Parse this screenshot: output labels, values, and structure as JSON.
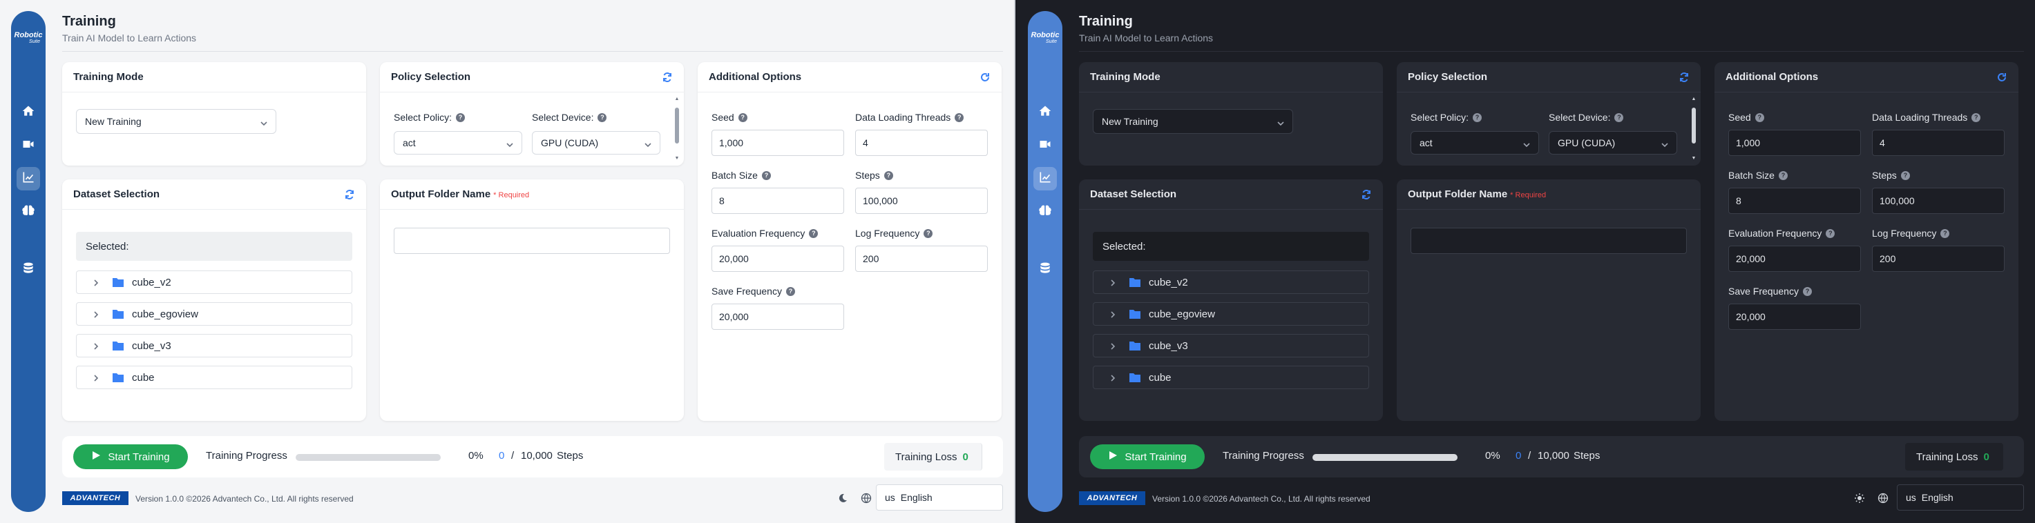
{
  "app": {
    "logo_text": "Robotic",
    "logo_sub": "Suite",
    "title": "Training",
    "subtitle": "Train AI Model to Learn Actions"
  },
  "sidebar": {
    "items": [
      {
        "icon": "home-icon"
      },
      {
        "icon": "video-icon"
      },
      {
        "icon": "chart-icon",
        "active": true
      },
      {
        "icon": "brain-icon"
      },
      {
        "icon": "database-icon"
      }
    ]
  },
  "training_mode": {
    "title": "Training Mode",
    "value": "New Training"
  },
  "policy": {
    "title": "Policy Selection",
    "policy_label": "Select Policy:",
    "policy_value": "act",
    "device_label": "Select Device:",
    "device_value": "GPU (CUDA)"
  },
  "dataset": {
    "title": "Dataset Selection",
    "selected_label": "Selected:",
    "items": [
      "cube_v2",
      "cube_egoview",
      "cube_v3",
      "cube"
    ]
  },
  "output": {
    "title": "Output Folder Name",
    "required": "* Required",
    "value": ""
  },
  "options": {
    "title": "Additional Options",
    "seed_label": "Seed",
    "seed": "1,000",
    "threads_label": "Data Loading Threads",
    "threads": "4",
    "batch_label": "Batch Size",
    "batch": "8",
    "steps_label": "Steps",
    "steps": "100,000",
    "eval_label": "Evaluation Frequency",
    "eval": "20,000",
    "log_label": "Log Frequency",
    "log": "200",
    "save_label": "Save Frequency",
    "save": "20,000"
  },
  "progress": {
    "start_label": "Start Training",
    "progress_label": "Training Progress",
    "fraction": 0,
    "percent": "0%",
    "current": "0",
    "slash": "/",
    "total": "10,000",
    "unit": "Steps",
    "loss_label": "Training Loss",
    "loss": "0"
  },
  "footer": {
    "brand": "ADVANTECH",
    "version": "Version 1.0.0 ©2026 Advantech Co., Ltd. All rights reserved",
    "lang_code": "us",
    "lang": "English"
  },
  "colors": {
    "accent": "#3b82f6",
    "start": "#22a857",
    "sidebar_light": "#255fa8",
    "sidebar_dark": "#4d82d2"
  }
}
